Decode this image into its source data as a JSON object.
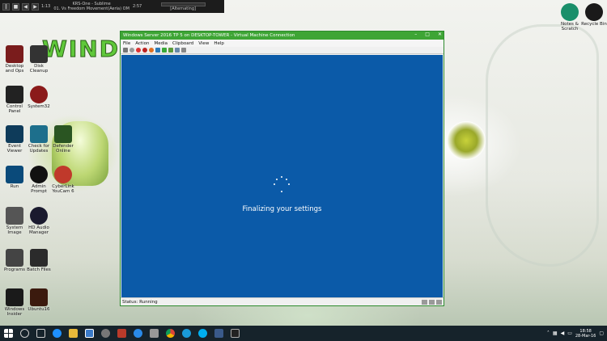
{
  "media_bar": {
    "track_title": "KRS-One - Sublime",
    "track_info": "01. Vs Freedom Movement(Aeria) OM",
    "time_left": "1:13",
    "time_right": "2:57",
    "status": "[Alternating]"
  },
  "desktop": {
    "wallpaper_text": "WIND",
    "icons": [
      {
        "label": "Desktop and Ops",
        "name": "desktop-icon-defrag"
      },
      {
        "label": "Disk Cleanup",
        "name": "desktop-icon-disk-cleanup"
      },
      {
        "label": "Control Panel",
        "name": "desktop-icon-control-panel"
      },
      {
        "label": "System32",
        "name": "desktop-icon-system32"
      },
      {
        "label": "Event Viewer",
        "name": "desktop-icon-event-viewer"
      },
      {
        "label": "Check for Updates",
        "name": "desktop-icon-check-updates"
      },
      {
        "label": "Defender Online",
        "name": "desktop-icon-defender-online"
      },
      {
        "label": "Run",
        "name": "desktop-icon-run"
      },
      {
        "label": "Admin Prompt",
        "name": "desktop-icon-admin-prompt"
      },
      {
        "label": "CyberLink YouCam 6",
        "name": "desktop-icon-youcam"
      },
      {
        "label": "System Image",
        "name": "desktop-icon-system-image"
      },
      {
        "label": "HD Audio Manager",
        "name": "desktop-icon-hd-audio"
      },
      {
        "label": "Programs",
        "name": "desktop-icon-programs"
      },
      {
        "label": "Batch Files",
        "name": "desktop-icon-batch-files"
      },
      {
        "label": "Windows Insider",
        "name": "desktop-icon-windows-insider"
      },
      {
        "label": "Ubuntu16",
        "name": "desktop-icon-ubuntu"
      },
      {
        "label": "Notes & Scratch",
        "name": "desktop-icon-notes"
      },
      {
        "label": "Recycle Bin",
        "name": "desktop-icon-recycle-bin"
      }
    ]
  },
  "vm_window": {
    "title": "Windows Server 2016 TP 5 on DESKTOP-TOWER - Virtual Machine Connection",
    "menu": [
      "File",
      "Action",
      "Media",
      "Clipboard",
      "View",
      "Help"
    ],
    "message": "Finalizing your settings",
    "status": "Status: Running",
    "accent_color": "#3ea535",
    "screen_color": "#0b5aa8"
  },
  "taskbar": {
    "time": "18:58",
    "date": "28-Mar-16"
  }
}
